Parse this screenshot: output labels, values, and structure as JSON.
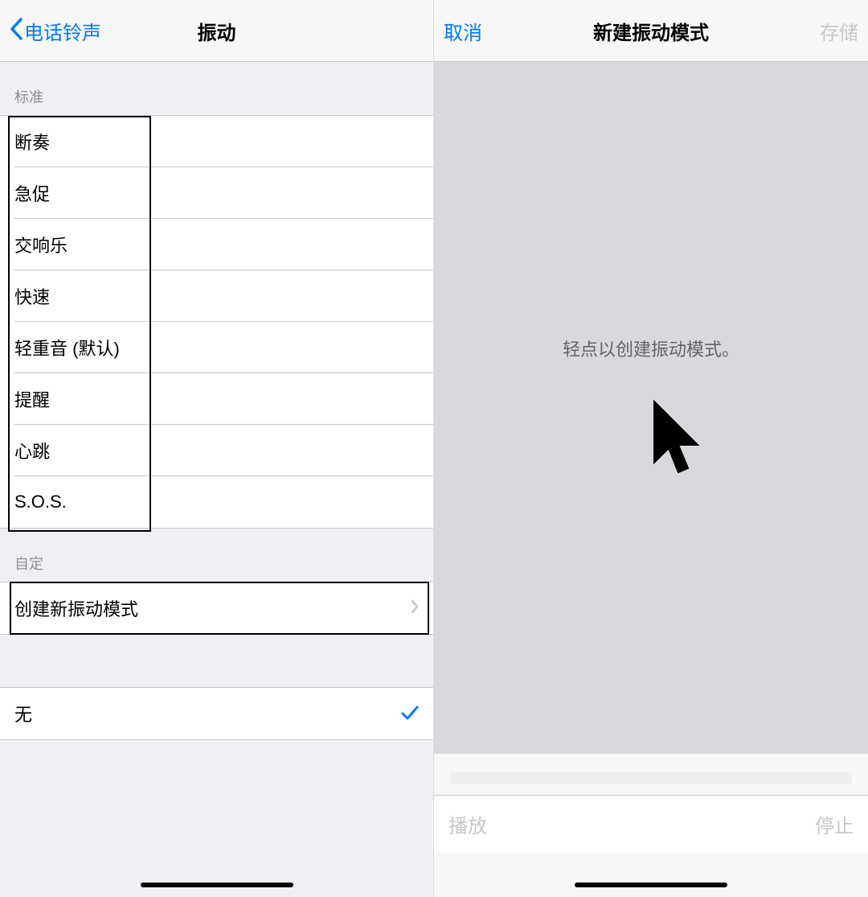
{
  "left": {
    "nav": {
      "back_label": "电话铃声",
      "title": "振动"
    },
    "sections": {
      "standard": {
        "header": "标准",
        "items": [
          "断奏",
          "急促",
          "交响乐",
          "快速",
          "轻重音 (默认)",
          "提醒",
          "心跳",
          "S.O.S."
        ]
      },
      "custom": {
        "header": "自定",
        "create_label": "创建新振动模式"
      },
      "none": {
        "label": "无",
        "selected": true
      }
    }
  },
  "right": {
    "nav": {
      "cancel": "取消",
      "title": "新建振动模式",
      "save": "存储"
    },
    "hint": "轻点以创建振动模式。",
    "controls": {
      "play": "播放",
      "stop": "停止"
    }
  },
  "colors": {
    "accent": "#007aff",
    "disabled": "#c7c7cc"
  }
}
